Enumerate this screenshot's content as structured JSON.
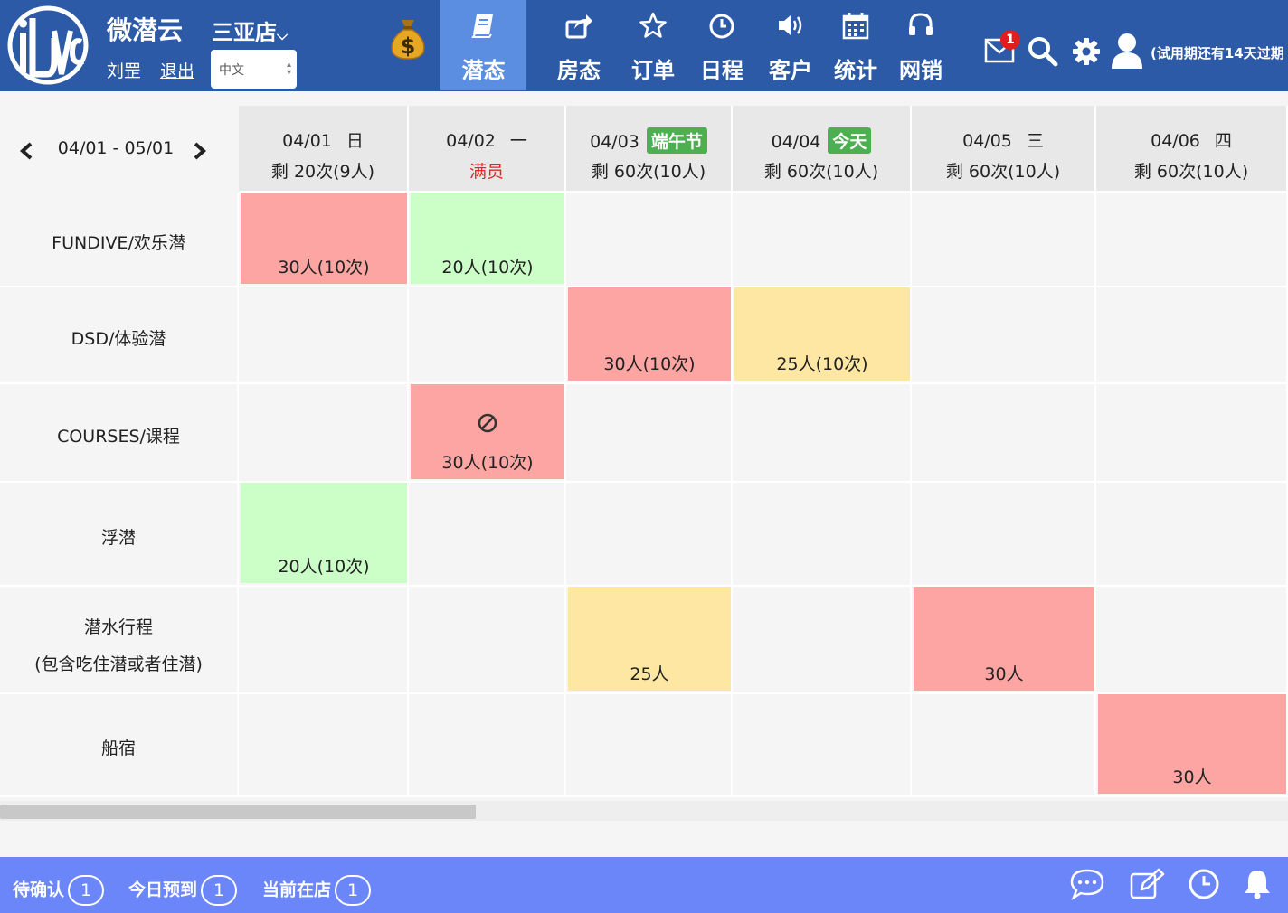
{
  "header": {
    "logo_text": "iDIVE",
    "brand": "微潜云",
    "store": "三亚店",
    "store_arrow": "⌵",
    "user": "刘罡",
    "logout": "退出",
    "language": "中文",
    "nav": [
      {
        "label": "潜态",
        "icon": "book-icon",
        "active": true
      },
      {
        "label": "房态",
        "icon": "share-icon"
      },
      {
        "label": "订单",
        "icon": "star-icon"
      },
      {
        "label": "日程",
        "icon": "clock-icon"
      },
      {
        "label": "客户",
        "icon": "speaker-icon"
      },
      {
        "label": "统计",
        "icon": "calendar-icon"
      },
      {
        "label": "网销",
        "icon": "headset-icon"
      }
    ],
    "mail_badge": "1",
    "trial_text": "(试用期还有14天过期"
  },
  "range": {
    "label": "04/01 - 05/01"
  },
  "columns": [
    {
      "date": "04/01",
      "weekday": "日",
      "remaining": "剩 20次(9人)"
    },
    {
      "date": "04/02",
      "weekday": "一",
      "remaining": "满员"
    },
    {
      "date": "04/03",
      "weekday": "",
      "tag": "端午节",
      "remaining": "剩 60次(10人)"
    },
    {
      "date": "04/04",
      "weekday": "",
      "tag": "今天",
      "remaining": "剩 60次(10人)"
    },
    {
      "date": "04/05",
      "weekday": "三",
      "remaining": "剩 60次(10人)"
    },
    {
      "date": "04/06",
      "weekday": "四",
      "remaining": "剩 60次(10人)"
    }
  ],
  "rows": [
    {
      "label": "FUNDIVE/欢乐潜",
      "label2": ""
    },
    {
      "label": "DSD/体验潜",
      "label2": ""
    },
    {
      "label": "COURSES/课程",
      "label2": ""
    },
    {
      "label": "浮潜",
      "label2": ""
    },
    {
      "label": "潜水行程",
      "label2": "(包含吃住潜或者住潜)"
    },
    {
      "label": "船宿",
      "label2": ""
    }
  ],
  "bookings": [
    {
      "text": "30人(10次)",
      "color": "red",
      "row": 0,
      "col": 0
    },
    {
      "text": "20人(10次)",
      "color": "green",
      "row": 0,
      "col": 1
    },
    {
      "text": "30人(10次)",
      "color": "red",
      "row": 1,
      "col": 2
    },
    {
      "text": "25人(10次)",
      "color": "yellow",
      "row": 1,
      "col": 3
    },
    {
      "text": "30人(10次)",
      "color": "red",
      "row": 2,
      "col": 1,
      "blocked": true
    },
    {
      "text": "20人(10次)",
      "color": "green",
      "row": 3,
      "col": 0
    },
    {
      "text": "25人",
      "color": "yellow",
      "row": 4,
      "col": 2
    },
    {
      "text": "30人",
      "color": "red",
      "row": 4,
      "col": 4
    },
    {
      "text": "30人",
      "color": "red",
      "row": 5,
      "col": 5
    }
  ],
  "footer": {
    "pending_label": "待确认",
    "pending_count": "1",
    "arrival_label": "今日预到",
    "arrival_count": "1",
    "instore_label": "当前在店",
    "instore_count": "1"
  },
  "colors": {
    "header": "#2d5aa6",
    "active_nav": "#5b8ee0",
    "footer": "#6b86f8",
    "red": "#fca5a3",
    "green": "#ccffc8",
    "yellow": "#fde7a3",
    "tag": "#4caf50"
  }
}
